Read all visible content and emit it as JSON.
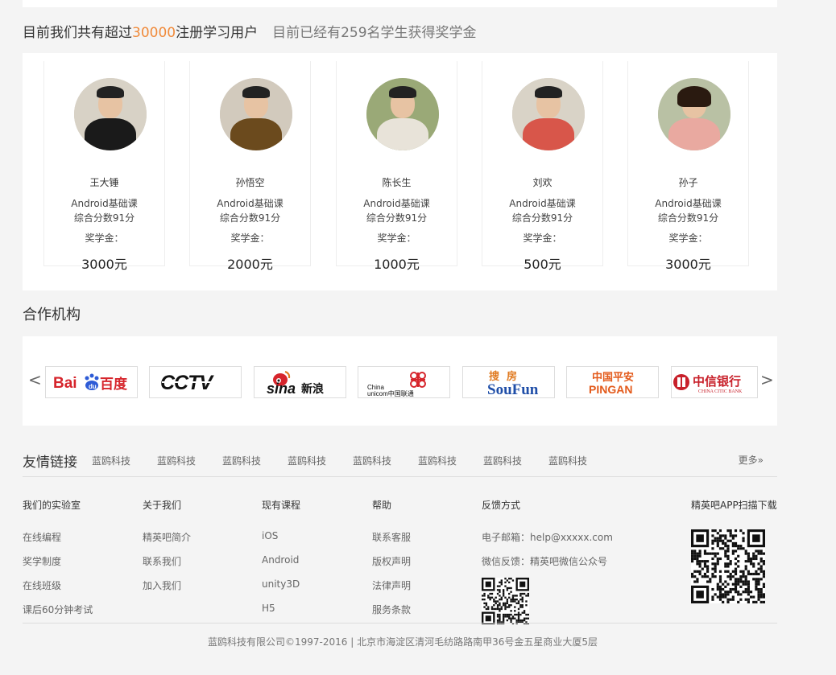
{
  "heading": {
    "main_prefix": "目前我们共有超过",
    "main_highlight": "30000",
    "main_suffix": "注册学习用户",
    "sub": "目前已经有259名学生获得奖学金"
  },
  "students": [
    {
      "name": "王大锤",
      "course": "Android基础课",
      "score": "综合分数91分",
      "scholarship_label": "奖学金：",
      "amount": "3000元",
      "shirt_color": "#1a1a1a",
      "bg_color": "#d8d2c6"
    },
    {
      "name": "孙悟空",
      "course": "Android基础课",
      "score": "综合分数91分",
      "scholarship_label": "奖学金：",
      "amount": "2000元",
      "shirt_color": "#6b4a1d",
      "bg_color": "#d2cabd"
    },
    {
      "name": "陈长生",
      "course": "Android基础课",
      "score": "综合分数91分",
      "scholarship_label": "奖学金：",
      "amount": "1000元",
      "shirt_color": "#e8e3d9",
      "bg_color": "#9aa977"
    },
    {
      "name": "刘欢",
      "course": "Android基础课",
      "score": "综合分数91分",
      "scholarship_label": "奖学金：",
      "amount": "500元",
      "shirt_color": "#d8564a",
      "bg_color": "#d9d3c7"
    },
    {
      "name": "孙子",
      "course": "Android基础课",
      "score": "综合分数91分",
      "scholarship_label": "奖学金：",
      "amount": "3000元",
      "shirt_color": "#e9a9a0",
      "bg_color": "#b9c1a4"
    }
  ],
  "partners": {
    "title": "合作机构",
    "prev_arrow": "<",
    "next_arrow": ">",
    "logos": [
      {
        "name": "Baidu百度"
      },
      {
        "name": "CCTV"
      },
      {
        "name": "sina新浪"
      },
      {
        "name": "China unicom中国联通"
      },
      {
        "name": "搜房SouFun"
      },
      {
        "name": "中国平安PINGAN"
      },
      {
        "name": "中信银行CHINA CITIC BANK"
      }
    ]
  },
  "friend_links": {
    "title": "友情链接",
    "items": [
      "蓝鸥科技",
      "蓝鸥科技",
      "蓝鸥科技",
      "蓝鸥科技",
      "蓝鸥科技",
      "蓝鸥科技",
      "蓝鸥科技",
      "蓝鸥科技"
    ],
    "more": "更多»"
  },
  "footer": {
    "columns": [
      {
        "title": "我们的实验室",
        "items": [
          "在线编程",
          "奖学制度",
          "在线班级",
          "课后60分钟考试"
        ]
      },
      {
        "title": "关于我们",
        "items": [
          "精英吧简介",
          "联系我们",
          "加入我们"
        ]
      },
      {
        "title": "现有课程",
        "items": [
          "iOS",
          "Android",
          "unity3D",
          "H5"
        ]
      },
      {
        "title": "帮助",
        "items": [
          "联系客服",
          "版权声明",
          "法律声明",
          "服务条款"
        ]
      },
      {
        "title": "反馈方式",
        "items": [
          "电子邮箱：help@xxxxx.com",
          "微信反馈：精英吧微信公众号"
        ]
      }
    ],
    "app_title": "精英吧APP扫描下载",
    "copyright": "蓝鸥科技有限公司©1997-2016 | 北京市海淀区清河毛纺路路南甲36号金五星商业大厦5层"
  }
}
